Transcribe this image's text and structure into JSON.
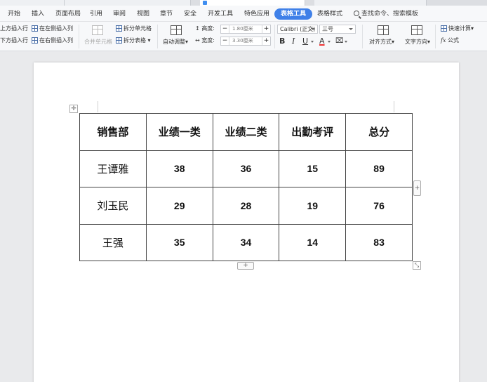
{
  "menu": {
    "tabs": [
      "开始",
      "插入",
      "页面布局",
      "引用",
      "审阅",
      "视图",
      "章节",
      "安全",
      "开发工具",
      "特色应用",
      "表格工具",
      "表格样式"
    ],
    "active_tab": "表格工具",
    "search_label": "查找命令、搜索模板"
  },
  "ribbon": {
    "insert_above": "上方插入行",
    "insert_below": "下方插入行",
    "insert_left": "在左侧插入列",
    "insert_right": "在右侧插入列",
    "merge_cells": "合并单元格",
    "split_cells": "拆分单元格",
    "split_table": "拆分表格",
    "auto_fit": "自动调整",
    "height_label": "高度:",
    "height_value": "1.80厘米",
    "width_label": "宽度:",
    "width_value": "3.30厘米",
    "font_name": "Calibri (正文)",
    "font_size": "三号",
    "bold": "B",
    "italic": "I",
    "underline": "U",
    "font_color": "A",
    "align": "对齐方式",
    "text_direction": "文字方向",
    "quick_calc": "快速计算",
    "formula": "公式",
    "fx": "fx"
  },
  "table": {
    "header": [
      "销售部",
      "业绩一类",
      "业绩二类",
      "出勤考评",
      "总分"
    ],
    "rows": [
      [
        "王谭雅",
        "38",
        "36",
        "15",
        "89"
      ],
      [
        "刘玉民",
        "29",
        "28",
        "19",
        "76"
      ],
      [
        "王强",
        "35",
        "34",
        "14",
        "83"
      ]
    ]
  }
}
